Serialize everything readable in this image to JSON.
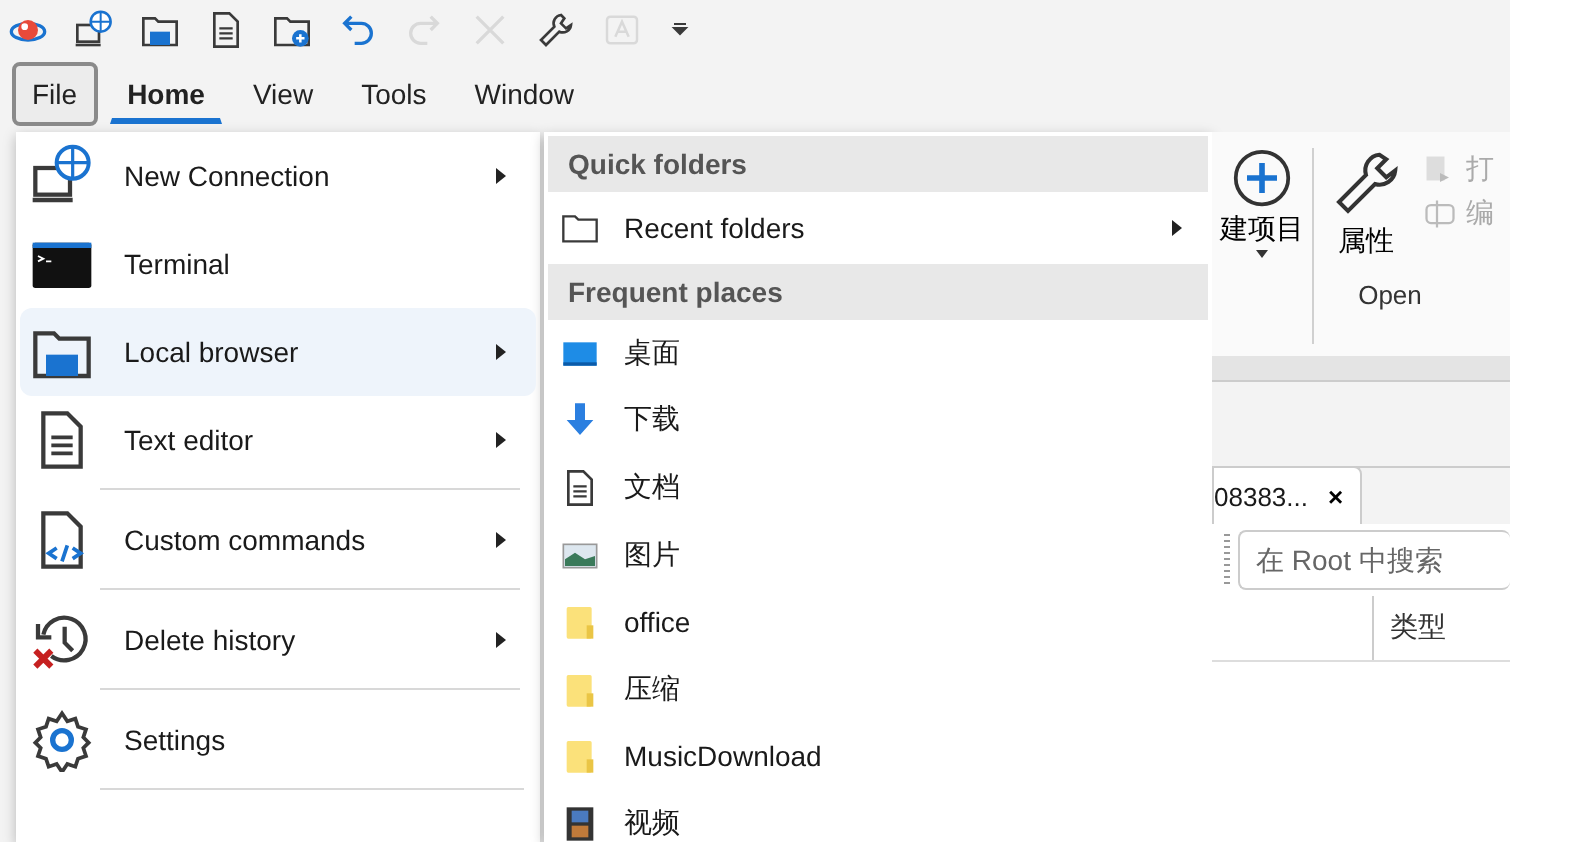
{
  "quick_access": [
    {
      "kind": "logo",
      "disabled": false
    },
    {
      "kind": "connection",
      "disabled": false
    },
    {
      "kind": "folder",
      "disabled": false
    },
    {
      "kind": "document",
      "disabled": false
    },
    {
      "kind": "folder-add",
      "disabled": false
    },
    {
      "kind": "undo",
      "disabled": false
    },
    {
      "kind": "redo",
      "disabled": true
    },
    {
      "kind": "close",
      "disabled": true
    },
    {
      "kind": "wrench",
      "disabled": false
    },
    {
      "kind": "text-box",
      "disabled": true
    },
    {
      "kind": "dropdown",
      "disabled": false
    }
  ],
  "ribbon_tabs": [
    {
      "label": "File",
      "selected": false,
      "pressed": true
    },
    {
      "label": "Home",
      "selected": true,
      "pressed": false
    },
    {
      "label": "View",
      "selected": false,
      "pressed": false
    },
    {
      "label": "Tools",
      "selected": false,
      "pressed": false
    },
    {
      "label": "Window",
      "selected": false,
      "pressed": false
    }
  ],
  "file_menu": [
    {
      "label": "New Connection",
      "kind": "connection",
      "submenu": true,
      "selected": false,
      "separator_before": false
    },
    {
      "label": "Terminal",
      "kind": "terminal",
      "submenu": false,
      "selected": false,
      "separator_before": false
    },
    {
      "label": "Local browser",
      "kind": "folder",
      "submenu": true,
      "selected": true,
      "separator_before": false
    },
    {
      "label": "Text editor",
      "kind": "document",
      "submenu": true,
      "selected": false,
      "separator_before": false
    },
    {
      "label": "Custom commands",
      "kind": "code",
      "submenu": true,
      "selected": false,
      "separator_before": true
    },
    {
      "label": "Delete history",
      "kind": "history",
      "submenu": true,
      "selected": false,
      "separator_before": true
    },
    {
      "label": "Settings",
      "kind": "gear",
      "submenu": false,
      "selected": false,
      "separator_before": true
    }
  ],
  "places_menu": [
    {
      "kind": "header",
      "label": "Quick folders"
    },
    {
      "kind": "folder-outline",
      "label": "Recent folders",
      "submenu": true
    },
    {
      "kind": "header",
      "label": "Frequent places"
    },
    {
      "kind": "desktop",
      "label": "桌面",
      "submenu": false
    },
    {
      "kind": "download",
      "label": "下载",
      "submenu": false
    },
    {
      "kind": "document",
      "label": "文档",
      "submenu": false
    },
    {
      "kind": "picture",
      "label": "图片",
      "submenu": false
    },
    {
      "kind": "folder-yellow",
      "label": "office",
      "submenu": false
    },
    {
      "kind": "folder-yellow",
      "label": "压缩",
      "submenu": false
    },
    {
      "kind": "folder-yellow",
      "label": "MusicDownload",
      "submenu": false
    },
    {
      "kind": "film",
      "label": "视频",
      "submenu": false
    }
  ],
  "ribbon": {
    "new_item_label": "建项目",
    "properties_label": "属性",
    "open_label": "打",
    "edit_label": "编",
    "group_label": "Open"
  },
  "file_tab": {
    "label": "08383...",
    "close": "×"
  },
  "search": {
    "placeholder": "在 Root 中搜索"
  },
  "columns": [
    "类型"
  ]
}
